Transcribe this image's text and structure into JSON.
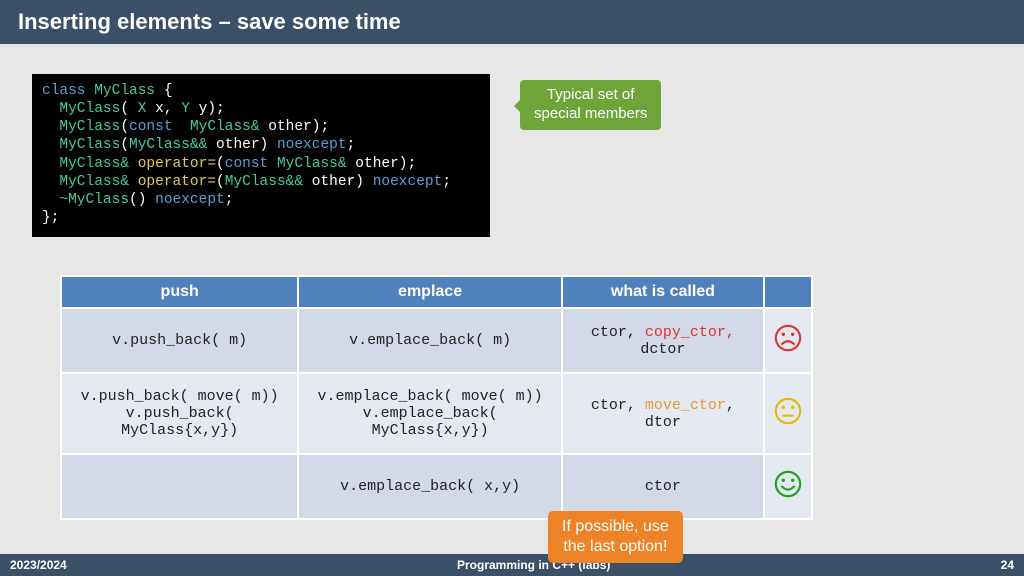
{
  "title": "Inserting elements – save some time",
  "code": {
    "l1": {
      "a": "class ",
      "b": "MyClass ",
      "c": "{"
    },
    "l2": {
      "a": "  MyClass",
      "b": "( ",
      "c": "X ",
      "d": "x, ",
      "e": "Y ",
      "f": "y);"
    },
    "l3": {
      "a": "  MyClass",
      "b": "(",
      "c": "const  ",
      "d": "MyClass& ",
      "e": "other);"
    },
    "l4": {
      "a": "  MyClass",
      "b": "(",
      "c": "MyClass&& ",
      "d": "other) ",
      "e": "noexcept",
      "f": ";"
    },
    "l5": {
      "a": "  MyClass& ",
      "b": "operator=",
      "c": "(",
      "d": "const ",
      "e": "MyClass& ",
      "f": "other);"
    },
    "l6": {
      "a": "  MyClass& ",
      "b": "operator=",
      "c": "(",
      "d": "MyClass&& ",
      "e": "other) ",
      "f": "noexcept",
      "g": ";"
    },
    "l7": {
      "a": "  ~MyClass",
      "b": "() ",
      "c": "noexcept",
      "d": ";"
    },
    "l8": "};"
  },
  "callout_green": {
    "l1": "Typical set of",
    "l2": "special members"
  },
  "callout_orange": {
    "l1": "If possible, use",
    "l2": "the last option!"
  },
  "table": {
    "headers": {
      "c1": "push",
      "c2": "emplace",
      "c3": "what is called"
    },
    "r1": {
      "push": "v.push_back( m)",
      "emplace": "v.emplace_back( m)",
      "call_a": "ctor, ",
      "call_b": "copy_ctor,",
      "call_c": " dctor"
    },
    "r2": {
      "push_a": "v.push_back( move( m))",
      "push_b": "v.push_back( MyClass{x,y})",
      "emp_a": "v.emplace_back( move( m))",
      "emp_b": "v.emplace_back( MyClass{x,y})",
      "call_a": "ctor, ",
      "call_b": "move_ctor",
      "call_c": ", dtor"
    },
    "r3": {
      "emplace": "v.emplace_back( x,y)",
      "call": "ctor"
    }
  },
  "footer": {
    "year": "2023/2024",
    "center": "Programming in C++ (labs)",
    "page": "24"
  }
}
